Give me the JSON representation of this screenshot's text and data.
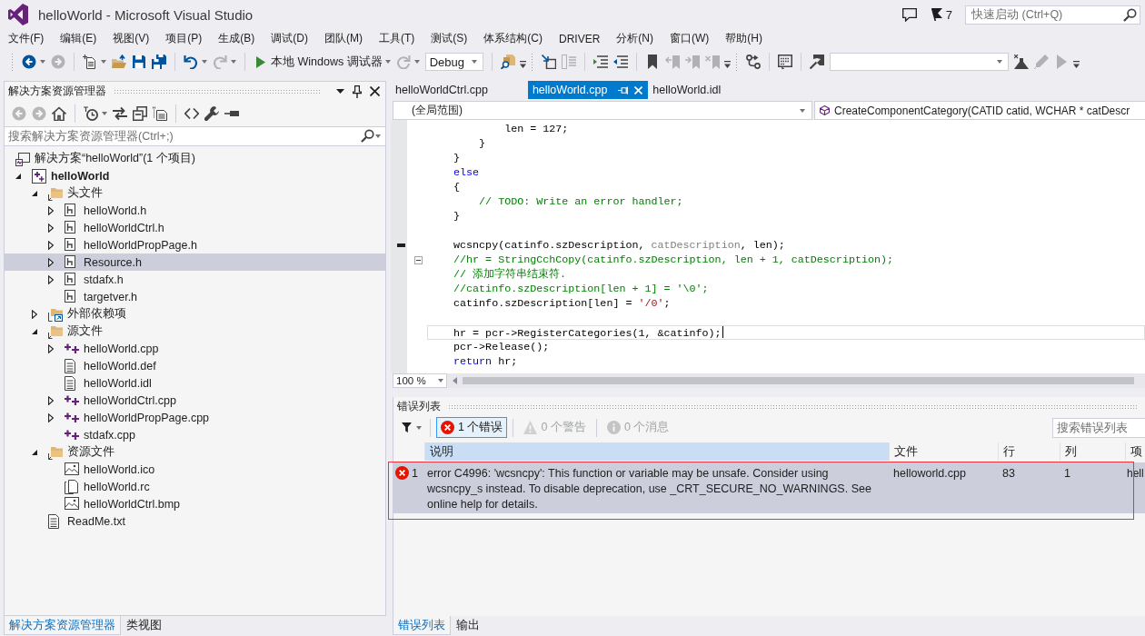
{
  "title_bar": {
    "title": "helloWorld - Microsoft Visual Studio",
    "notification_count": "7",
    "quick_launch": {
      "placeholder": "快速启动 (Ctrl+Q)"
    }
  },
  "menu": [
    "文件(F)",
    "编辑(E)",
    "视图(V)",
    "项目(P)",
    "生成(B)",
    "调试(D)",
    "团队(M)",
    "工具(T)",
    "测试(S)",
    "体系结构(C)",
    "DRIVER",
    "分析(N)",
    "窗口(W)",
    "帮助(H)"
  ],
  "toolbar": [
    {
      "kind": "grip"
    },
    {
      "kind": "back",
      "disabled": false,
      "dropdown": true
    },
    {
      "kind": "forward",
      "disabled": true
    },
    {
      "kind": "separator"
    },
    {
      "kind": "new-project",
      "disabled": false,
      "dropdown": true
    },
    {
      "kind": "open",
      "disabled": false
    },
    {
      "kind": "save",
      "disabled": false
    },
    {
      "kind": "save-all",
      "disabled": false
    },
    {
      "kind": "separator"
    },
    {
      "kind": "undo",
      "disabled": false,
      "dropdown": true
    },
    {
      "kind": "redo",
      "disabled": true,
      "dropdown": true
    },
    {
      "kind": "separator"
    },
    {
      "kind": "run",
      "label": "本地 Windows 调试器",
      "disabled": false,
      "dropdown": true
    },
    {
      "kind": "restart",
      "disabled": true,
      "dropdown": true
    },
    {
      "kind": "combo",
      "value": "Debug"
    },
    {
      "kind": "separator"
    },
    {
      "kind": "find",
      "disabled": false
    },
    {
      "kind": "overflow"
    },
    {
      "kind": "grip"
    },
    {
      "kind": "frame-arrow",
      "disabled": false
    },
    {
      "kind": "frame-lines",
      "disabled": true
    },
    {
      "kind": "separator"
    },
    {
      "kind": "indent",
      "disabled": false
    },
    {
      "kind": "outdent",
      "disabled": false
    },
    {
      "kind": "separator"
    },
    {
      "kind": "bookmark",
      "disabled": false
    },
    {
      "kind": "bookmark-prev",
      "disabled": true
    },
    {
      "kind": "bookmark-next",
      "disabled": true
    },
    {
      "kind": "bookmark-clear",
      "disabled": true
    },
    {
      "kind": "overflow"
    },
    {
      "kind": "grip"
    },
    {
      "kind": "branch",
      "disabled": false
    },
    {
      "kind": "separator"
    },
    {
      "kind": "list-window",
      "disabled": false
    },
    {
      "kind": "separator"
    },
    {
      "kind": "attach",
      "disabled": false
    },
    {
      "kind": "combo"
    },
    {
      "kind": "flask",
      "disabled": false
    },
    {
      "kind": "pencil",
      "disabled": true
    },
    {
      "kind": "play",
      "disabled": true
    },
    {
      "kind": "overflow"
    }
  ],
  "solution_explorer": {
    "title": "解决方案资源管理器",
    "toolbar": [
      {
        "kind": "back",
        "disabled": true
      },
      {
        "kind": "forward",
        "disabled": true
      },
      {
        "kind": "home",
        "disabled": false
      },
      {
        "kind": "separator"
      },
      {
        "kind": "history",
        "disabled": false,
        "dropdown": true
      },
      {
        "kind": "sync",
        "disabled": false
      },
      {
        "kind": "collapse",
        "disabled": false
      },
      {
        "kind": "show-all",
        "disabled": false
      },
      {
        "kind": "separator"
      },
      {
        "kind": "code",
        "disabled": false
      },
      {
        "kind": "wrench",
        "disabled": false
      },
      {
        "kind": "pin-line",
        "disabled": false
      }
    ],
    "search": {
      "placeholder": "搜索解决方案资源管理器(Ctrl+;)"
    },
    "tree": [
      {
        "label": "解决方案“helloWorld”(1 个项目)",
        "kind": "solution",
        "selected": false,
        "children": [
          {
            "label": "helloWorld",
            "kind": "project",
            "expanded": true,
            "selected": false,
            "children": [
              {
                "label": "头文件",
                "kind": "folder",
                "expanded": true,
                "selected": false,
                "children": [
                  {
                    "label": "helloWorld.h",
                    "kind": "header",
                    "expanded": false,
                    "selected": false
                  },
                  {
                    "label": "helloWorldCtrl.h",
                    "kind": "header",
                    "expanded": false,
                    "selected": false
                  },
                  {
                    "label": "helloWorldPropPage.h",
                    "kind": "header",
                    "expanded": false,
                    "selected": false
                  },
                  {
                    "label": "Resource.h",
                    "kind": "header",
                    "expanded": false,
                    "selected": true
                  },
                  {
                    "label": "stdafx.h",
                    "kind": "header",
                    "expanded": false,
                    "selected": false
                  },
                  {
                    "label": "targetver.h",
                    "kind": "header",
                    "selected": false
                  }
                ]
              },
              {
                "label": "外部依赖项",
                "kind": "references",
                "expanded": false,
                "selected": false
              },
              {
                "label": "源文件",
                "kind": "folder",
                "expanded": true,
                "selected": false,
                "children": [
                  {
                    "label": "helloWorld.cpp",
                    "kind": "source",
                    "expanded": false,
                    "selected": false
                  },
                  {
                    "label": "helloWorld.def",
                    "kind": "text",
                    "selected": false
                  },
                  {
                    "label": "helloWorld.idl",
                    "kind": "text",
                    "selected": false
                  },
                  {
                    "label": "helloWorldCtrl.cpp",
                    "kind": "source",
                    "expanded": false,
                    "selected": false
                  },
                  {
                    "label": "helloWorldPropPage.cpp",
                    "kind": "source",
                    "expanded": false,
                    "selected": false
                  },
                  {
                    "label": "stdafx.cpp",
                    "kind": "source",
                    "selected": false
                  }
                ]
              },
              {
                "label": "资源文件",
                "kind": "folder",
                "expanded": true,
                "selected": false,
                "children": [
                  {
                    "label": "helloWorld.ico",
                    "kind": "image",
                    "selected": false
                  },
                  {
                    "label": "helloWorld.rc",
                    "kind": "resource",
                    "selected": false
                  },
                  {
                    "label": "helloWorldCtrl.bmp",
                    "kind": "image",
                    "selected": false
                  }
                ]
              },
              {
                "label": "ReadMe.txt",
                "kind": "text",
                "selected": false
              }
            ]
          }
        ]
      }
    ],
    "tabs": [
      {
        "label": "解决方案资源管理器",
        "selected": true
      },
      {
        "label": "类视图",
        "selected": false
      }
    ]
  },
  "editor": {
    "tabs": [
      {
        "label": "helloWorldCtrl.cpp",
        "selected": false
      },
      {
        "label": "helloWorld.cpp",
        "selected": true
      },
      {
        "label": "helloWorld.idl",
        "selected": false
      }
    ],
    "scope": "(全局范围)",
    "member": "CreateComponentCategory(CATID catid, WCHAR * catDescr",
    "lines": [
      {
        "current": false,
        "tokens": [
          {
            "kind": "plain",
            "text": "            len = 127;"
          }
        ]
      },
      {
        "current": false,
        "tokens": [
          {
            "kind": "plain",
            "text": "        }"
          }
        ]
      },
      {
        "current": false,
        "tokens": [
          {
            "kind": "plain",
            "text": "    }"
          }
        ]
      },
      {
        "current": false,
        "tokens": [
          {
            "kind": "keyword",
            "text": "    else"
          }
        ]
      },
      {
        "current": false,
        "tokens": [
          {
            "kind": "plain",
            "text": "    {"
          }
        ]
      },
      {
        "current": false,
        "tokens": [
          {
            "kind": "comment",
            "text": "        // TODO: Write an error handler;"
          }
        ]
      },
      {
        "current": false,
        "tokens": [
          {
            "kind": "plain",
            "text": "    }"
          }
        ]
      },
      {
        "current": false
      },
      {
        "current": false,
        "marked": true,
        "tokens": [
          {
            "kind": "plain",
            "text": "    wcsncpy(catinfo.szDescription, "
          },
          {
            "kind": "parameter",
            "text": "catDescription"
          },
          {
            "kind": "plain",
            "text": ", len);"
          }
        ]
      },
      {
        "current": false,
        "fold": true,
        "tokens": [
          {
            "kind": "comment",
            "text": "    //hr = StringCchCopy(catinfo.szDescription, len + 1, catDescription);"
          }
        ]
      },
      {
        "current": false,
        "tokens": [
          {
            "kind": "comment",
            "text": "    // 添加字符串结束符."
          }
        ]
      },
      {
        "current": false,
        "tokens": [
          {
            "kind": "comment",
            "text": "    //catinfo.szDescription[len + 1] = '\\0';"
          }
        ]
      },
      {
        "current": false,
        "tokens": [
          {
            "kind": "plain",
            "text": "    catinfo.szDescription[len] = "
          },
          {
            "kind": "string",
            "text": "'/0'"
          },
          {
            "kind": "plain",
            "text": ";"
          }
        ]
      },
      {
        "current": false
      },
      {
        "current": true,
        "tokens": [
          {
            "kind": "plain",
            "text": "    hr = pcr->RegisterCategories(1, &catinfo);"
          }
        ]
      },
      {
        "current": false,
        "tokens": [
          {
            "kind": "plain",
            "text": "    pcr->Release();"
          }
        ]
      },
      {
        "current": false,
        "tokens": [
          {
            "kind": "keyword",
            "text": "    return"
          },
          {
            "kind": "plain",
            "text": " hr;"
          }
        ]
      }
    ],
    "zoom": "100 %"
  },
  "error_list": {
    "title": "错误列表",
    "filters": [
      {
        "kind": "error",
        "label": "1 个错误",
        "selected": true
      },
      {
        "kind": "warning",
        "label": "0 个警告",
        "selected": false
      },
      {
        "kind": "message",
        "label": "0 个消息",
        "selected": false
      }
    ],
    "search": {
      "placeholder": "搜索错误列表"
    },
    "columns": [
      {
        "label": "说明",
        "selected": true
      },
      {
        "label": "文件",
        "selected": false
      },
      {
        "label": "行",
        "selected": false
      },
      {
        "label": "列",
        "selected": false
      },
      {
        "label": "项",
        "selected": false
      }
    ],
    "rows": [
      {
        "kind": "error",
        "number": "1",
        "cells": [
          "error C4996: 'wcsncpy': This function or variable may be unsafe. Consider using wcsncpy_s instead. To disable deprecation, use _CRT_SECURE_NO_WARNINGS. See online help for details.",
          "helloworld.cpp",
          "83",
          "1",
          "hell"
        ],
        "selected": true,
        "outlined": true
      }
    ],
    "tabs": [
      {
        "label": "错误列表",
        "selected": true
      },
      {
        "label": "输出",
        "selected": false
      }
    ]
  }
}
